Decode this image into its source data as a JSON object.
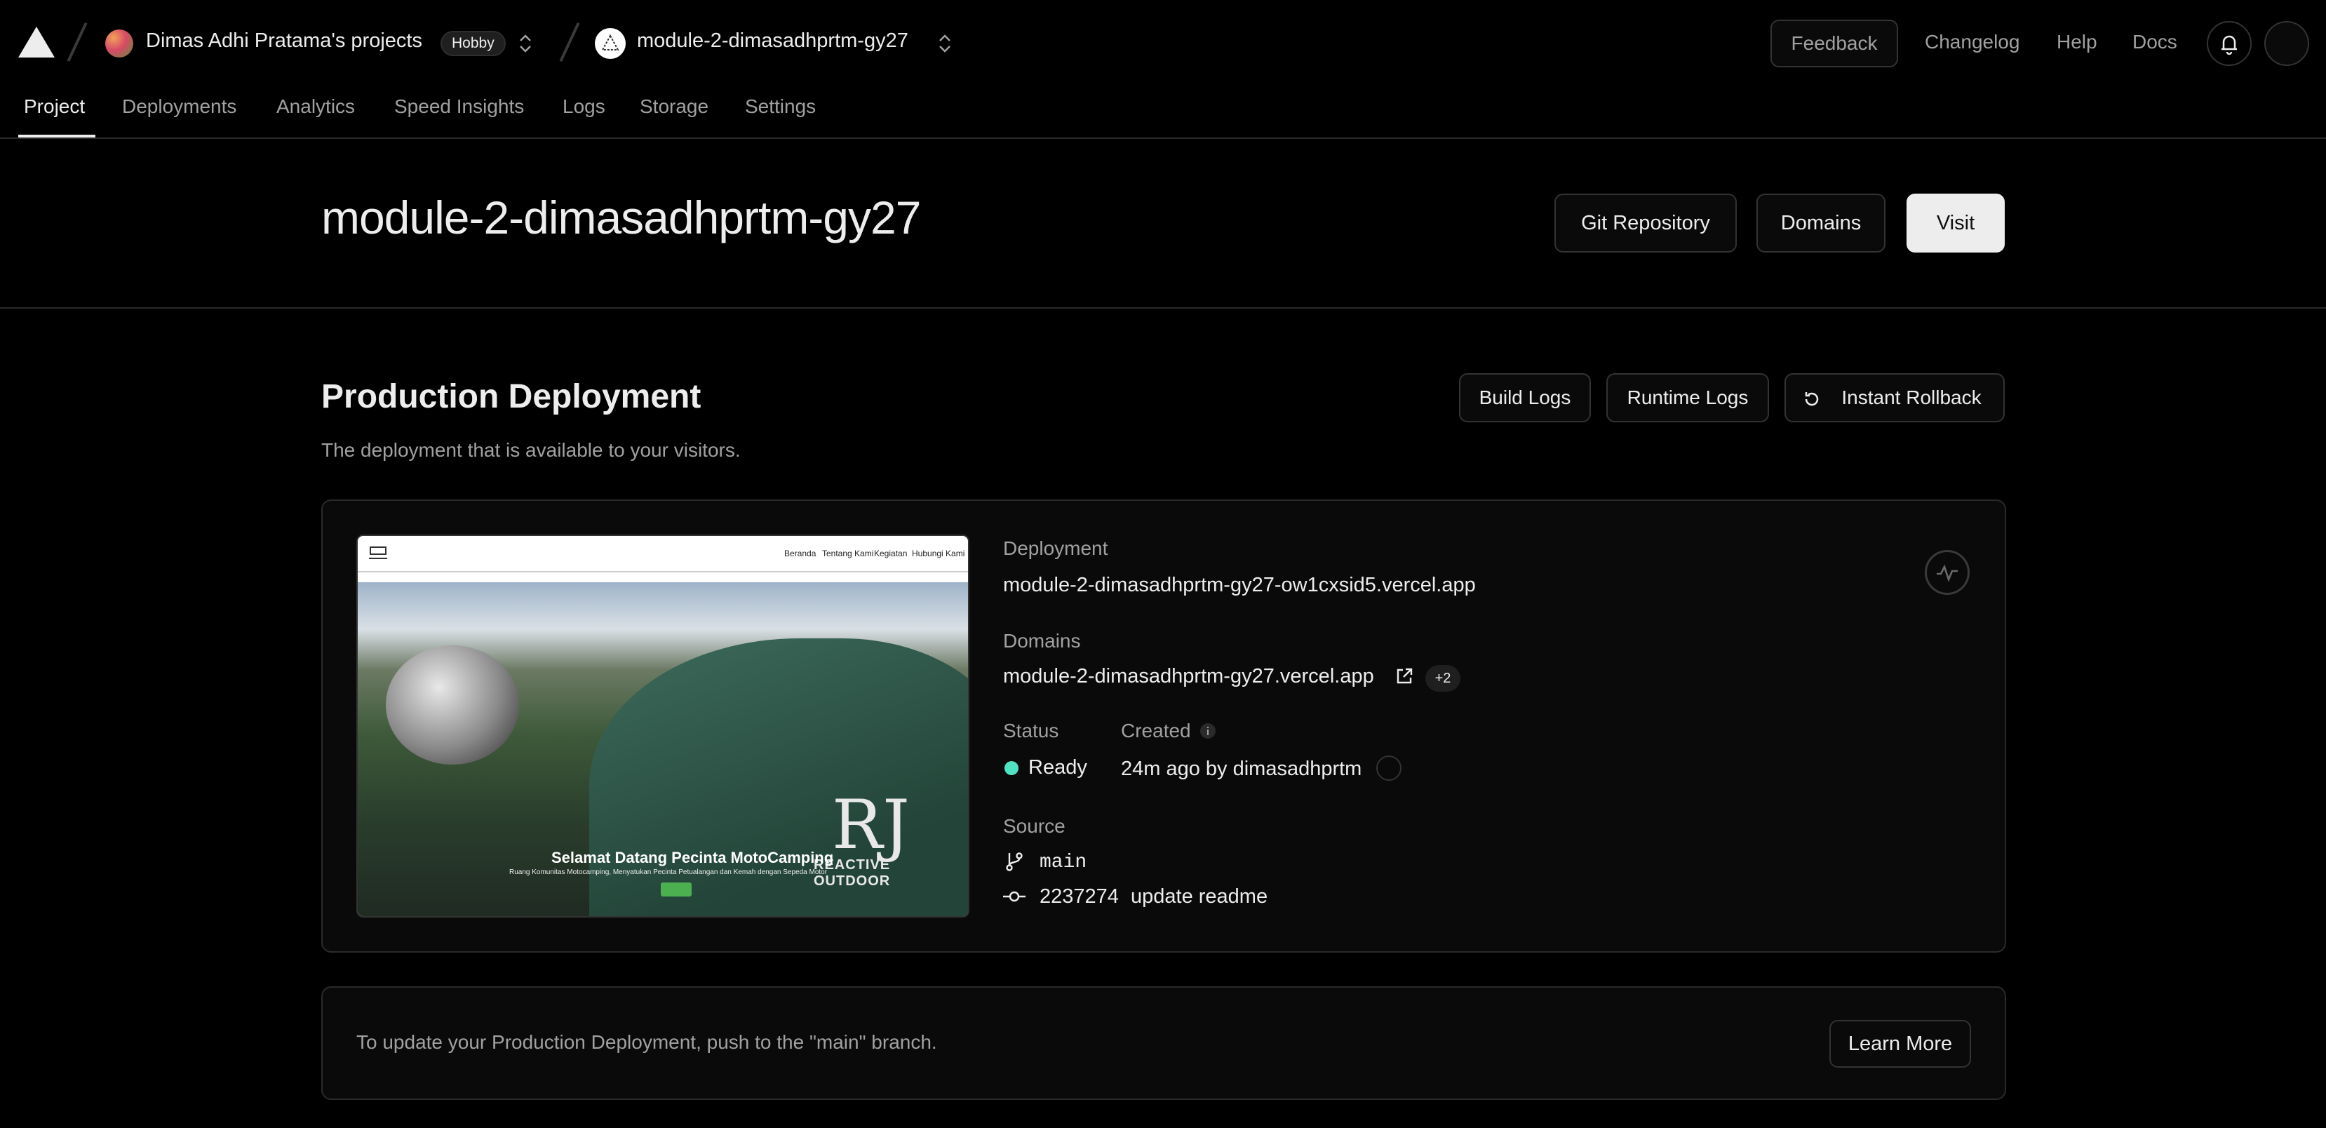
{
  "topbar": {
    "team_name": "Dimas Adhi Pratama's projects",
    "plan_badge": "Hobby",
    "project_name": "module-2-dimasadhprtm-gy27",
    "feedback_label": "Feedback",
    "links": [
      "Changelog",
      "Help",
      "Docs"
    ]
  },
  "tabs": [
    "Project",
    "Deployments",
    "Analytics",
    "Speed Insights",
    "Logs",
    "Storage",
    "Settings"
  ],
  "header": {
    "title": "module-2-dimasadhprtm-gy27",
    "git_label": "Git Repository",
    "domains_label": "Domains",
    "visit_label": "Visit"
  },
  "production": {
    "title": "Production Deployment",
    "subtitle": "The deployment that is available to your visitors.",
    "build_logs": "Build Logs",
    "runtime_logs": "Runtime Logs",
    "rollback": "Instant Rollback",
    "deployment_label": "Deployment",
    "deployment_url": "module-2-dimasadhprtm-gy27-ow1cxsid5.vercel.app",
    "domains_label": "Domains",
    "domain_url": "module-2-dimasadhprtm-gy27.vercel.app",
    "domain_extra": "+2",
    "status_label": "Status",
    "status_value": "Ready",
    "status_color": "#50e3c2",
    "created_label": "Created",
    "created_value": "24m ago by dimasadhprtm",
    "source_label": "Source",
    "branch": "main",
    "commit_hash": "2237274",
    "commit_msg": "update readme",
    "preview": {
      "nav": [
        "Beranda",
        "Tentang Kami",
        "Kegiatan",
        "Hubungi Kami"
      ],
      "headline": "Selamat Datang Pecinta MotoCamping",
      "tagline": "Ruang Komunitas Motocamping, Menyatukan Pecinta Petualangan dan Kemah dengan Sepeda Motor",
      "brand": "REACTIVE OUTDOOR"
    }
  },
  "notice": {
    "text": "To update your Production Deployment, push to the \"main\" branch.",
    "learn_more": "Learn More"
  }
}
